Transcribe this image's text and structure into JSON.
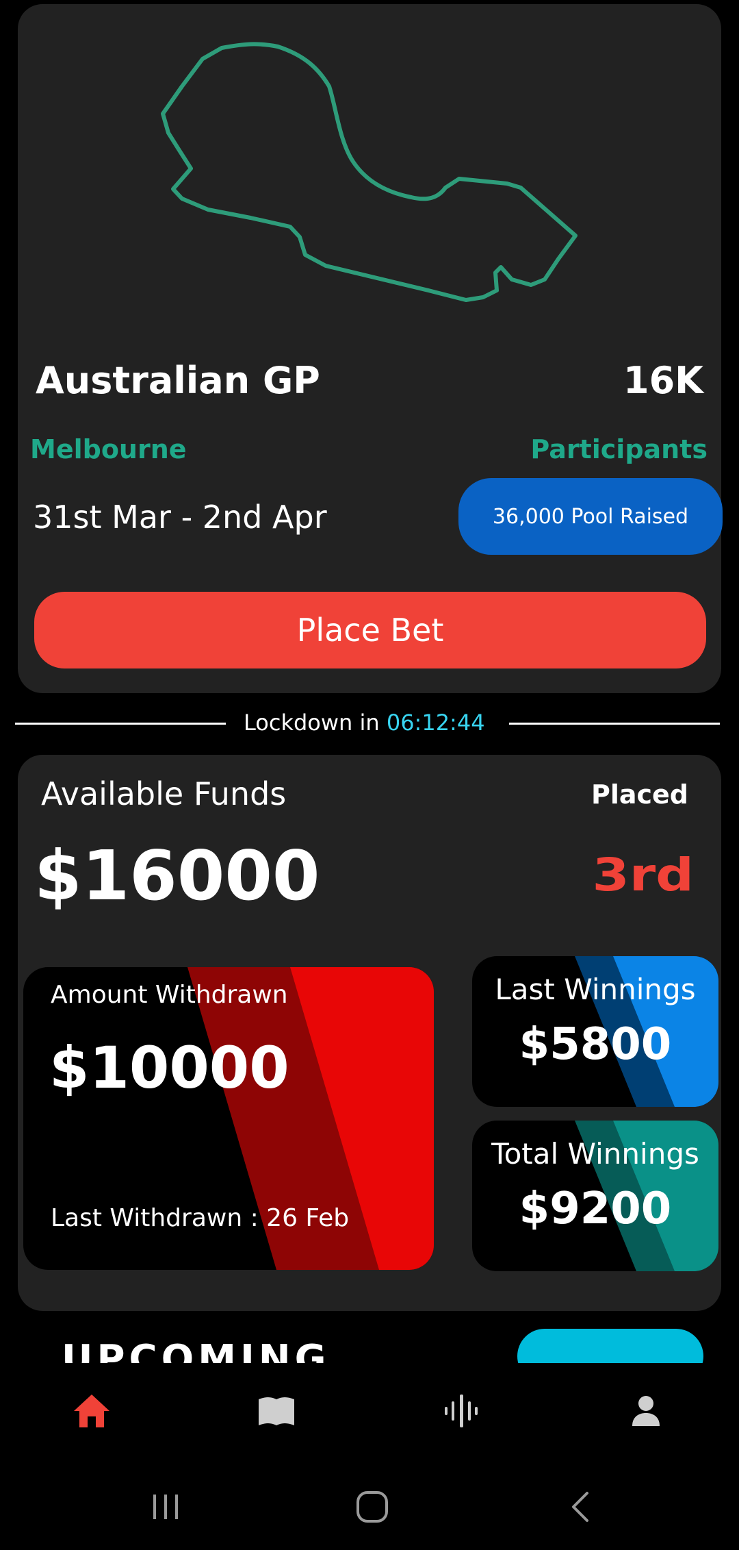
{
  "race": {
    "title": "Australian GP",
    "participants_count": "16K",
    "city": "Melbourne",
    "participants_label": "Participants",
    "date": "31st Mar - 2nd Apr",
    "pool": "36,000 Pool Raised",
    "bet_label": "Place Bet"
  },
  "lockdown": {
    "label": "Lockdown in",
    "timer": "06:12:44"
  },
  "funds": {
    "label": "Available Funds",
    "value": "$16000",
    "placed_label": "Placed",
    "rank": "3rd",
    "withdrawn": {
      "label": "Amount Withdrawn",
      "value": "$10000",
      "last": "Last Withdrawn : 26 Feb"
    },
    "last_winnings": {
      "label": "Last Winnings",
      "value": "$5800"
    },
    "total_winnings": {
      "label": "Total Winnings",
      "value": "$9200"
    }
  },
  "upcoming_peek": "UPCOMING",
  "colors": {
    "accent_red": "#f04238",
    "teal": "#1fa98a",
    "pool_blue": "#0a62c4",
    "timer_cyan": "#38d4f0"
  },
  "nav": {
    "items": [
      {
        "icon": "home-icon",
        "active": true
      },
      {
        "icon": "map-icon",
        "active": false
      },
      {
        "icon": "audio-wave-icon",
        "active": false
      },
      {
        "icon": "profile-icon",
        "active": false
      }
    ]
  },
  "system_nav": [
    "recents-icon",
    "home-circle-icon",
    "back-icon"
  ]
}
